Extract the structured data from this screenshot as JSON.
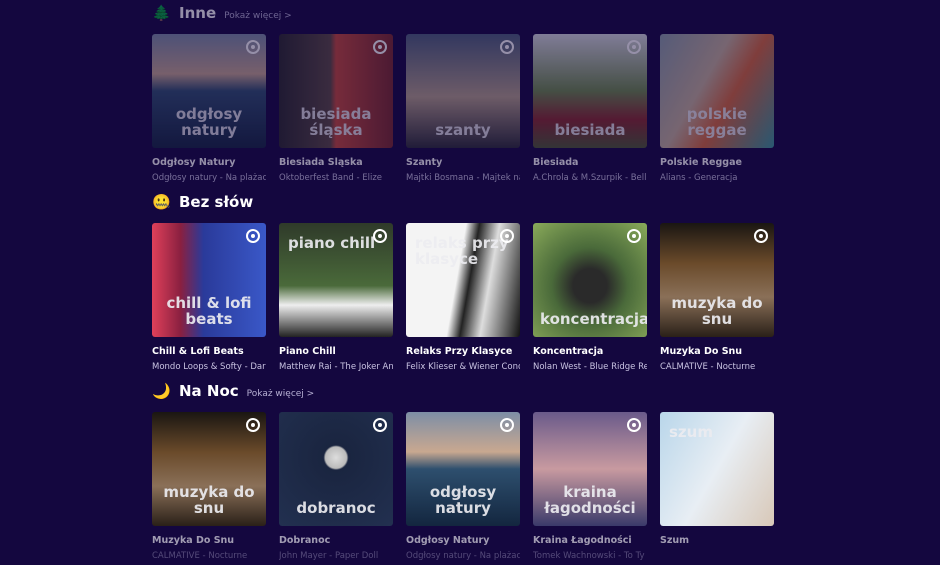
{
  "sections": [
    {
      "icon": "🌲",
      "title": "Inne",
      "more": "Pokaż więcej >",
      "cards": [
        {
          "cover": "odgłosy natury",
          "title": "Odgłosy Natury",
          "subtitle": "Odgłosy natury - Na plażach",
          "bg": "linear-gradient(#7d8ea6 0%,#c9a890 35%,#2e4f6e 50%,#13263f 100%)"
        },
        {
          "cover": "biesiada śląska",
          "title": "Biesiada Śląska",
          "subtitle": "Oktoberfest Band - Elize",
          "bg": "linear-gradient(90deg,#2a2a2a 0%,#5a4a40 45%,#c84a38 50%,#7a2a2a 100%)"
        },
        {
          "cover": "szanty",
          "title": "Szanty",
          "subtitle": "Majtki Bosmana - Majtek na",
          "bg": "linear-gradient(#4c607a,#b7a28a 55%,#2b2d34 100%)"
        },
        {
          "cover": "biesiada",
          "title": "Biesiada",
          "subtitle": "A.Chrola & M.Szurpik - Bella",
          "bg": "linear-gradient(#d9dde0,#6d8a4a 50%,#8a2a2a 75%,#4d5a30 100%)"
        },
        {
          "cover": "polskie reggae",
          "title": "Polskie Reggae",
          "subtitle": "Alians - Generacja",
          "bg": "linear-gradient(120deg,#8ca0a8,#c8b39a 40%,#d86a3a 60%,#3a9a9a 100%)"
        }
      ]
    },
    {
      "icon": "🤐",
      "title": "Bez słów",
      "more": "",
      "cards": [
        {
          "cover": "chill & lofi beats",
          "title": "Chill & Lofi Beats",
          "subtitle": "Mondo Loops & Softy - Dar",
          "bg": "linear-gradient(90deg,#e0405a 0%,#8a2040 25%,#2a3a9a 45%,#3a58c8 100%)"
        },
        {
          "cover": "piano chill",
          "title": "Piano Chill",
          "subtitle": "Matthew Rai - The Joker And",
          "bg": "linear-gradient(#2f3a2a,#4a6a3a 55%,#eee 72%,#222 100%)"
        },
        {
          "cover": "relaks przy klasyce",
          "title": "Relaks Przy Klasyce",
          "subtitle": "Felix Klieser & Wiener Conc",
          "bg": "linear-gradient(100deg,#f4f4f4 45%,#222 55%,#ddd 70%,#111 100%)"
        },
        {
          "cover": "koncentracja",
          "title": "Koncentracja",
          "subtitle": "Nolan West - Blue Ridge Re",
          "bg": "radial-gradient(circle at 50% 55%,#2a2a2a 20%,#4a6a3a 45%,#8aaa5a 100%)"
        },
        {
          "cover": "muzyka do snu",
          "title": "Muzyka Do Snu",
          "subtitle": "CALMATIVE - Nocturne",
          "bg": "linear-gradient(#1a1612,#6a4a2a 35%,#8a7058 65%,#2a2018 100%)"
        }
      ]
    },
    {
      "icon": "🌙",
      "title": "Na Noc",
      "more": "Pokaż więcej >",
      "cards": [
        {
          "cover": "muzyka do snu",
          "title": "Muzyka Do Snu",
          "subtitle": "CALMATIVE - Nocturne",
          "bg": "linear-gradient(#1a1612,#6a4a2a 35%,#8a7058 65%,#2a2018 100%)"
        },
        {
          "cover": "dobranoc",
          "title": "Dobranoc",
          "subtitle": "John Mayer - Paper Doll",
          "bg": "radial-gradient(circle at 50% 40%,#ddd 0,#bbb 12%,#1a2540 14%,#223050 100%)"
        },
        {
          "cover": "odgłosy natury",
          "title": "Odgłosy Natury",
          "subtitle": "Odgłosy natury - Na plażach",
          "bg": "linear-gradient(#7d8ea6 0%,#c9a890 35%,#2e4f6e 50%,#13263f 100%)"
        },
        {
          "cover": "kraina łagodności",
          "title": "Kraina Łagodności",
          "subtitle": "Tomek Wachnowski - To Ty",
          "bg": "linear-gradient(#6a5a8a,#c89aa0 50%,#3a3a6a 100%)"
        },
        {
          "cover": "szum",
          "title": "Szum",
          "subtitle": "",
          "bg": "linear-gradient(120deg,#b9d6ea,#e8eef4 50%,#d8c8b8 100%)"
        }
      ]
    }
  ]
}
